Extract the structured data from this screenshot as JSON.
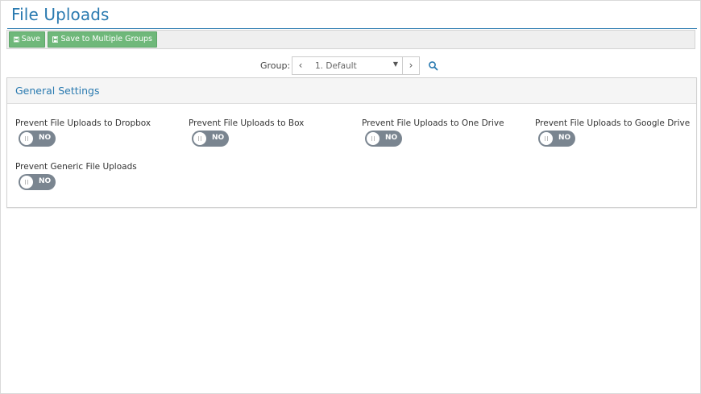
{
  "page": {
    "title": "File Uploads"
  },
  "toolbar": {
    "save_label": "Save",
    "save_multiple_label": "Save to Multiple Groups"
  },
  "group": {
    "label": "Group:",
    "selected": "1. Default",
    "prev": "‹",
    "next": "›"
  },
  "panel": {
    "title": "General Settings"
  },
  "settings": [
    {
      "label": "Prevent File Uploads to Dropbox",
      "state": "NO"
    },
    {
      "label": "Prevent File Uploads to Box",
      "state": "NO"
    },
    {
      "label": "Prevent File Uploads to One Drive",
      "state": "NO"
    },
    {
      "label": "Prevent File Uploads to Google Drive",
      "state": "NO"
    },
    {
      "label": "Prevent Generic File Uploads",
      "state": "NO"
    }
  ],
  "colors": {
    "accent": "#2a7ab0",
    "button": "#6fb87a",
    "toggle_off": "#7a8590"
  },
  "icons": {
    "save": "floppy-disk-icon",
    "search": "search-icon"
  }
}
